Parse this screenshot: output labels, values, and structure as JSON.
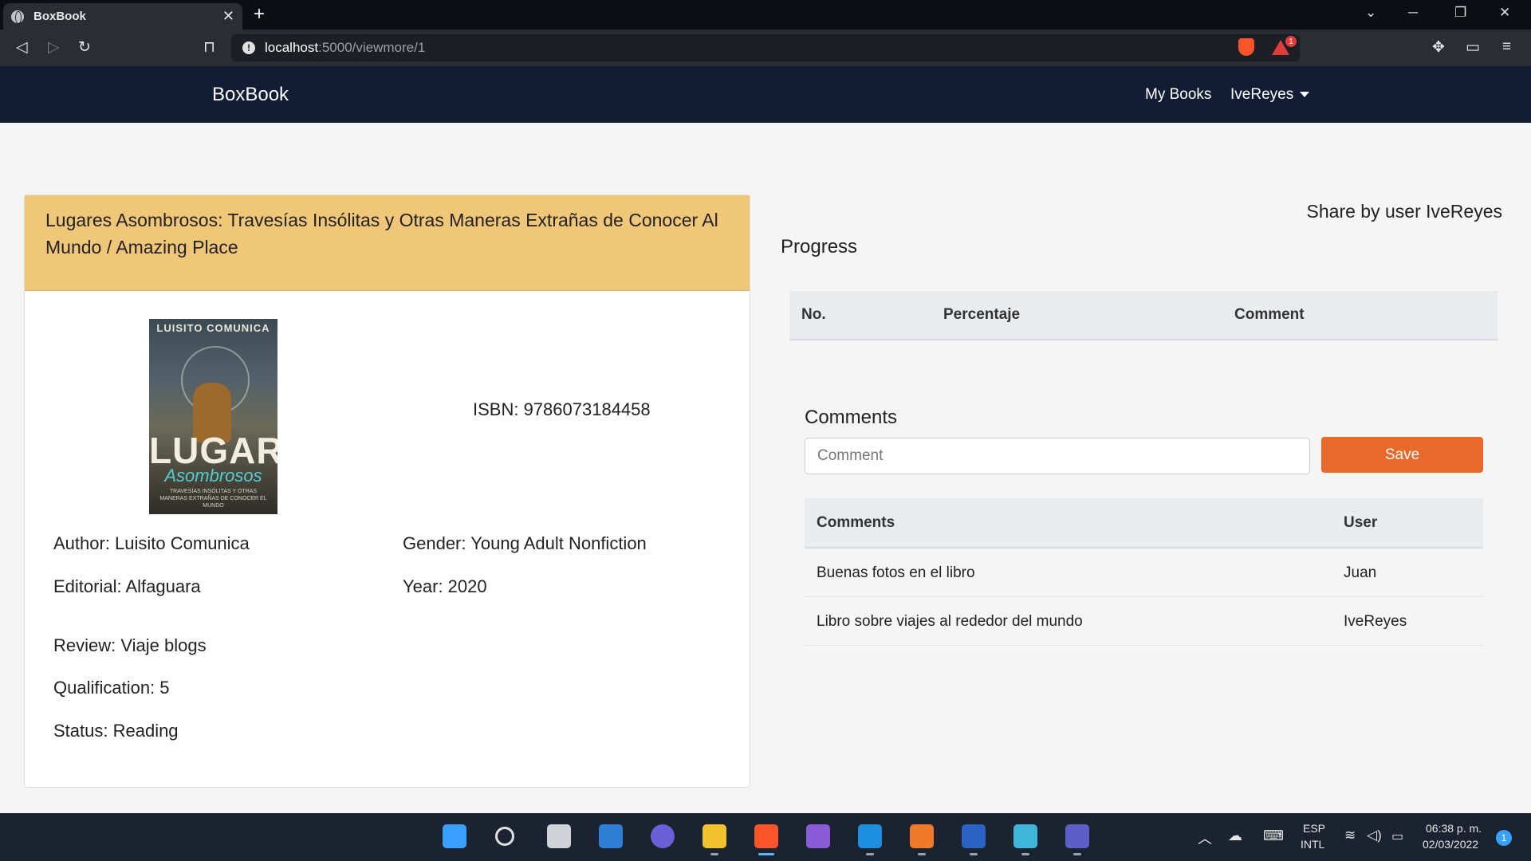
{
  "browser": {
    "tab_title": "BoxBook",
    "tab_close": "✕",
    "new_tab": "+",
    "url_host": "localhost",
    "url_path": ":5000/viewmore/1",
    "shields_badge": "1"
  },
  "navbar": {
    "brand": "BoxBook",
    "my_books": "My Books",
    "user": "IveReyes"
  },
  "book": {
    "title": "Lugares Asombrosos: Travesías Insólitas y Otras Maneras Extrañas de Conocer Al Mundo / Amazing Place",
    "cover": {
      "top_text": "LUISITO COMUNICA",
      "big_text": "LUGARES",
      "sub_text": "Asombrosos",
      "tiny_text": "TRAVESÍAS INSÓLITAS Y OTRAS MANERAS EXTRAÑAS DE CONOCER EL MUNDO"
    },
    "isbn": "ISBN: 9786073184458",
    "author": "Author: Luisito Comunica",
    "gender": "Gender: Young Adult Nonfiction",
    "editorial": "Editorial: Alfaguara",
    "year": "Year: 2020",
    "review": "Review: Viaje blogs",
    "qualification": "Qualification: 5",
    "status": "Status: Reading"
  },
  "share": "Share by user IveReyes",
  "progress": {
    "title": "Progress",
    "columns": [
      "No.",
      "Percentaje",
      "Comment"
    ]
  },
  "comments": {
    "title": "Comments",
    "placeholder": "Comment",
    "save_label": "Save",
    "columns": [
      "Comments",
      "User"
    ],
    "rows": [
      {
        "comment": "Buenas fotos en el libro",
        "user": "Juan"
      },
      {
        "comment": "Libro sobre viajes al rededor del mundo",
        "user": "IveReyes"
      }
    ]
  },
  "taskbar": {
    "lang_top": "ESP",
    "lang_bottom": "INTL",
    "time": "06:38 p. m.",
    "date": "02/03/2022",
    "notifications": "1"
  }
}
